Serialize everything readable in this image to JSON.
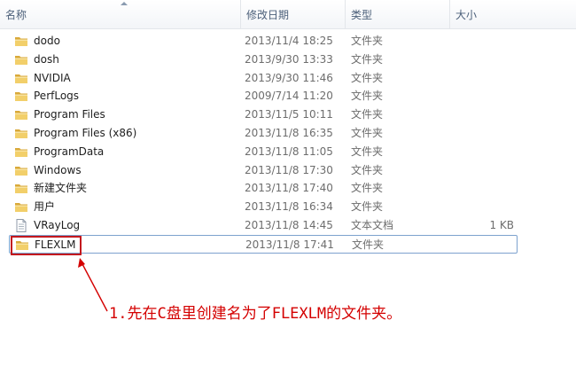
{
  "columns": {
    "name": "名称",
    "date": "修改日期",
    "type": "类型",
    "size": "大小"
  },
  "files": [
    {
      "name": "dodo",
      "date": "2013/11/4 18:25",
      "type": "文件夹",
      "size": "",
      "icon": "folder-icon"
    },
    {
      "name": "dosh",
      "date": "2013/9/30 13:33",
      "type": "文件夹",
      "size": "",
      "icon": "folder-icon"
    },
    {
      "name": "NVIDIA",
      "date": "2013/9/30 11:46",
      "type": "文件夹",
      "size": "",
      "icon": "folder-icon"
    },
    {
      "name": "PerfLogs",
      "date": "2009/7/14 11:20",
      "type": "文件夹",
      "size": "",
      "icon": "folder-icon"
    },
    {
      "name": "Program Files",
      "date": "2013/11/5 10:11",
      "type": "文件夹",
      "size": "",
      "icon": "folder-icon"
    },
    {
      "name": "Program Files (x86)",
      "date": "2013/11/8 16:35",
      "type": "文件夹",
      "size": "",
      "icon": "folder-icon"
    },
    {
      "name": "ProgramData",
      "date": "2013/11/8 11:05",
      "type": "文件夹",
      "size": "",
      "icon": "folder-icon"
    },
    {
      "name": "Windows",
      "date": "2013/11/8 17:30",
      "type": "文件夹",
      "size": "",
      "icon": "folder-icon"
    },
    {
      "name": "新建文件夹",
      "date": "2013/11/8 17:40",
      "type": "文件夹",
      "size": "",
      "icon": "folder-icon"
    },
    {
      "name": "用户",
      "date": "2013/11/8 16:34",
      "type": "文件夹",
      "size": "",
      "icon": "folder-icon"
    },
    {
      "name": "VRayLog",
      "date": "2013/11/8 14:45",
      "type": "文本文档",
      "size": "1 KB",
      "icon": "text-file-icon"
    },
    {
      "name": "FLEXLM",
      "date": "2013/11/8 17:41",
      "type": "文件夹",
      "size": "",
      "icon": "folder-icon",
      "selected": true
    }
  ],
  "annotation": {
    "caption": "1.先在C盘里创建名为了FLEXLM的文件夹。",
    "color": "#d40000"
  },
  "colors": {
    "folder": "#e8c25c",
    "selection_border": "#7da2ce",
    "highlight_box": "#c3181e"
  }
}
